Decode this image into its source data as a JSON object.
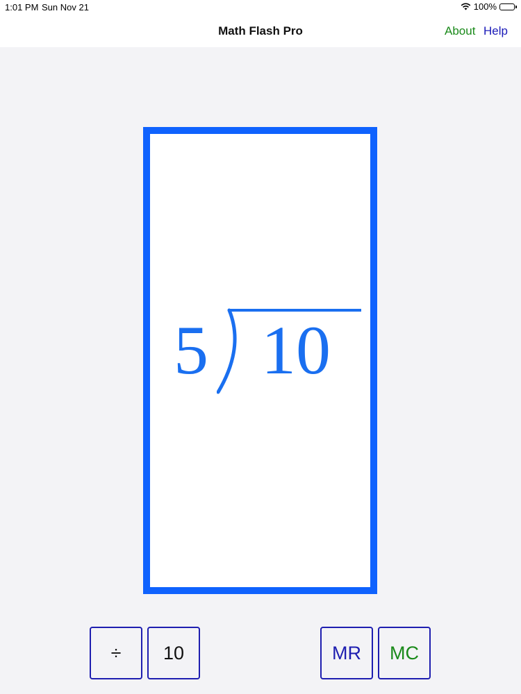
{
  "status_bar": {
    "time": "1:01 PM",
    "date": "Sun Nov 21",
    "battery": "100%",
    "battery_level": 1.0,
    "icons": [
      "wifi-icon",
      "battery-icon"
    ]
  },
  "nav": {
    "title": "Math Flash Pro",
    "about_label": "About",
    "help_label": "Help"
  },
  "card": {
    "divisor": "5",
    "dividend": "10",
    "problem_color": "#1a6ff0",
    "border_color": "#0f62fe"
  },
  "keys": {
    "operation": "÷",
    "value": "10",
    "mr": "MR",
    "mc": "MC"
  },
  "colors": {
    "about": "#1a8a1a",
    "help": "#1a1ab8",
    "mr": "#1e1eb0",
    "mc": "#1a8a1a",
    "key_border": "#1e1eb0"
  }
}
